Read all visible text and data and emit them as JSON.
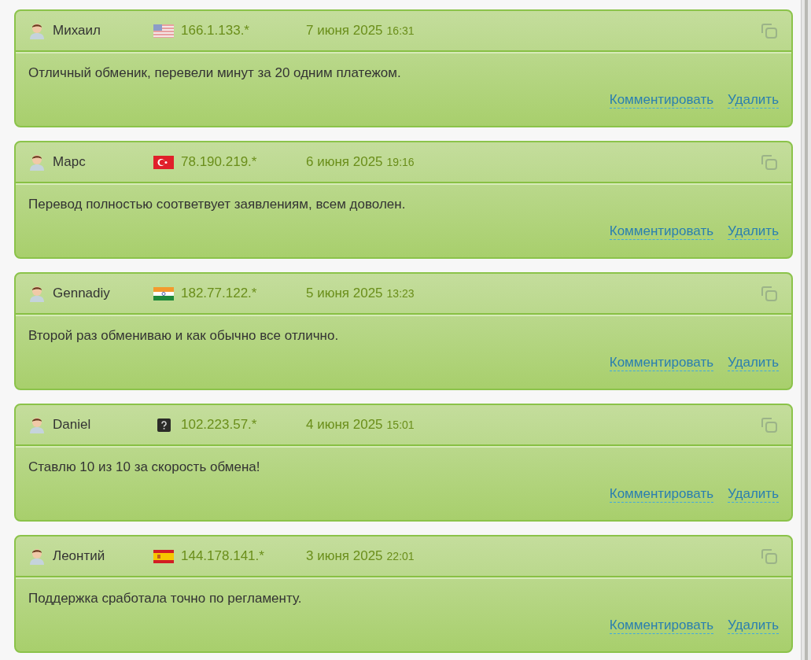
{
  "reviews": [
    {
      "author": "Михаил",
      "flag": {
        "kind": "us"
      },
      "ip": "166.1.133.*",
      "date": "7 июня 2025",
      "time": "16:31",
      "text": "Отличный обменик, перевели минут за 20 одним платежом.",
      "actions": [
        "Комментировать",
        "Удалить"
      ]
    },
    {
      "author": "Марс",
      "flag": {
        "kind": "tr"
      },
      "ip": "78.190.219.*",
      "date": "6 июня 2025",
      "time": "19:16",
      "text": "Перевод полностью соответвует заявлениям, всем доволен.",
      "actions": [
        "Комментировать",
        "Удалить"
      ]
    },
    {
      "author": "Gennadiy",
      "flag": {
        "kind": "in"
      },
      "ip": "182.77.122.*",
      "date": "5 июня 2025",
      "time": "13:23",
      "text": "Второй раз обмениваю и как обычно все отлично.",
      "actions": [
        "Комментировать",
        "Удалить"
      ]
    },
    {
      "author": "Daniel",
      "flag": {
        "kind": "unknown"
      },
      "ip": "102.223.57.*",
      "date": "4 июня 2025",
      "time": "15:01",
      "text": "Ставлю 10 из 10 за скорость обмена!",
      "actions": [
        "Комментировать",
        "Удалить"
      ]
    },
    {
      "author": "Леонтий",
      "flag": {
        "kind": "es"
      },
      "ip": "144.178.141.*",
      "date": "3 июня 2025",
      "time": "22:01",
      "text": "Поддержка сработала точно по регламенту.",
      "actions": [
        "Комментировать",
        "Удалить"
      ]
    }
  ]
}
